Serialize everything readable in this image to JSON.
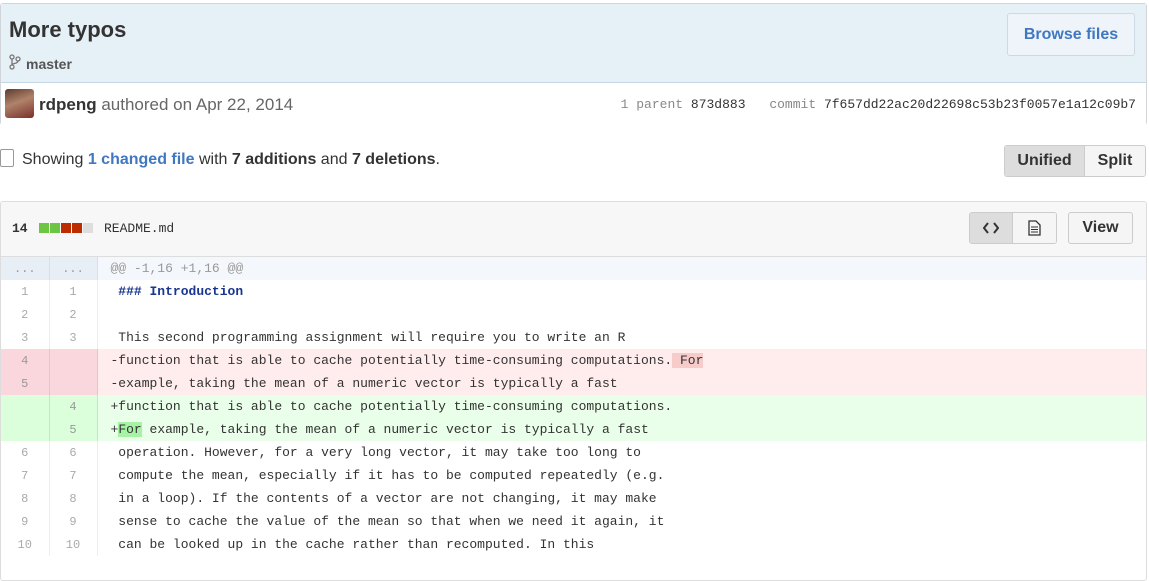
{
  "commit": {
    "title": "More typos",
    "branch": "master",
    "browse_label": "Browse files",
    "author": "rdpeng",
    "authored_text": "authored on Apr 22, 2014",
    "parent_label": "1 parent",
    "parent_sha": "873d883",
    "commit_label": "commit",
    "commit_sha": "7f657dd22ac20d22698c53b23f0057e1a12c09b7"
  },
  "toc": {
    "showing": "Showing",
    "changed_files": "1 changed file",
    "with": "with",
    "additions": "7 additions",
    "and": "and",
    "deletions": "7 deletions",
    "period": ".",
    "unified_label": "Unified",
    "split_label": "Split"
  },
  "file": {
    "change_count": "14",
    "name": "README.md",
    "view_label": "View",
    "stat_blocks": [
      "add",
      "add",
      "del",
      "del",
      "neutral"
    ],
    "colors": {
      "add": "#6cc644",
      "del": "#bd2c00",
      "neutral": "#ddd"
    }
  },
  "diff": {
    "hunk": "@@ -1,16 +1,16 @@",
    "hunk_dots": "...",
    "lines": [
      {
        "type": "ctx",
        "old": "1",
        "new": "1",
        "text": " ### Introduction"
      },
      {
        "type": "ctx",
        "old": "2",
        "new": "2",
        "text": " "
      },
      {
        "type": "ctx",
        "old": "3",
        "new": "3",
        "text": " This second programming assignment will require you to write an R"
      },
      {
        "type": "del",
        "old": "4",
        "new": "",
        "text": "-function that is able to cache potentially time-consuming computations.",
        "hl": " For"
      },
      {
        "type": "del",
        "old": "5",
        "new": "",
        "text": "-example, taking the mean of a numeric vector is typically a fast"
      },
      {
        "type": "add",
        "old": "",
        "new": "4",
        "text": "+function that is able to cache potentially time-consuming computations."
      },
      {
        "type": "add",
        "old": "",
        "new": "5",
        "prefix": "+",
        "hl": "For",
        "text": " example, taking the mean of a numeric vector is typically a fast"
      },
      {
        "type": "ctx",
        "old": "6",
        "new": "6",
        "text": " operation. However, for a very long vector, it may take too long to"
      },
      {
        "type": "ctx",
        "old": "7",
        "new": "7",
        "text": " compute the mean, especially if it has to be computed repeatedly (e.g."
      },
      {
        "type": "ctx",
        "old": "8",
        "new": "8",
        "text": " in a loop). If the contents of a vector are not changing, it may make"
      },
      {
        "type": "ctx",
        "old": "9",
        "new": "9",
        "text": " sense to cache the value of the mean so that when we need it again, it"
      },
      {
        "type": "ctx",
        "old": "10",
        "new": "10",
        "text": " can be looked up in the cache rather than recomputed. In this"
      }
    ]
  }
}
